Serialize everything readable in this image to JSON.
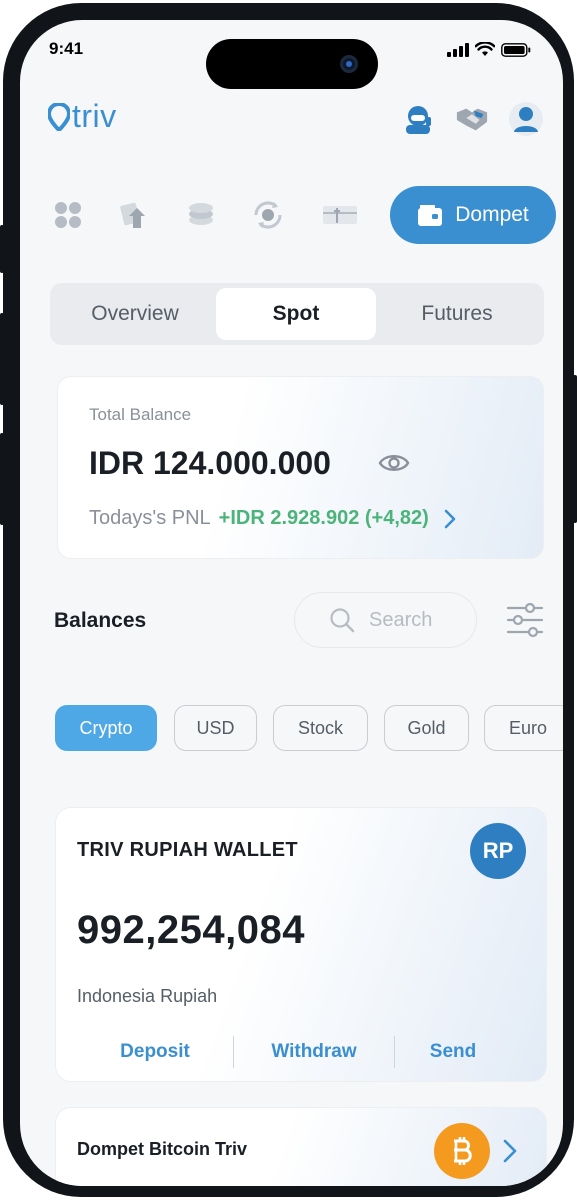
{
  "status_bar": {
    "time": "9:41"
  },
  "app": {
    "logo_text": "triv"
  },
  "nav": {
    "active_label": "Dompet"
  },
  "tabs": [
    {
      "label": "Overview",
      "active": false
    },
    {
      "label": "Spot",
      "active": true
    },
    {
      "label": "Futures",
      "active": false
    }
  ],
  "balance_card": {
    "label": "Total Balance",
    "value": "IDR 124.000.000",
    "pnl_label": "Todays's PNL",
    "pnl_value": "+IDR 2.928.902 (+4,82)"
  },
  "balances": {
    "title": "Balances",
    "search_placeholder": "Search"
  },
  "chips": [
    {
      "label": "Crypto",
      "active": true
    },
    {
      "label": "USD",
      "active": false
    },
    {
      "label": "Stock",
      "active": false
    },
    {
      "label": "Gold",
      "active": false
    },
    {
      "label": "Euro",
      "active": false
    }
  ],
  "wallet_card": {
    "title": "TRIV RUPIAH WALLET",
    "badge": "RP",
    "amount": "992,254,084",
    "currency_name": "Indonesia Rupiah",
    "actions": [
      "Deposit",
      "Withdraw",
      "Send"
    ]
  },
  "bitcoin_card": {
    "title": "Dompet Bitcoin Triv"
  },
  "colors": {
    "primary": "#3a8fd0",
    "positive": "#4cb47a",
    "bitcoin": "#f39a1f"
  }
}
